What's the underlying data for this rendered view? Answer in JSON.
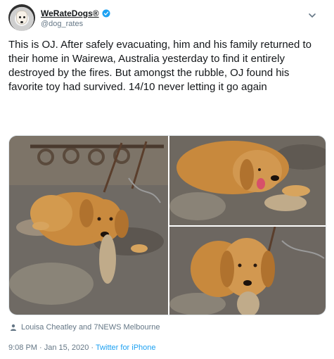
{
  "tweet": {
    "display_name": "WeRateDogs®",
    "handle": "@dog_rates",
    "text": "This is OJ. After safely evacuating, him and his family returned to their home in Wairewa, Australia yesterday to find it entirely destroyed by the fires. But amongst the rubble, OJ found his favorite toy had survived. 14/10 never letting it go again",
    "media_credit": "Louisa Cheatley and 7NEWS Melbourne",
    "time": "9:08 PM · Jan 15, 2020 · ",
    "source": "Twitter for iPhone"
  },
  "icons": {
    "verified": "verified-badge-icon",
    "menu": "chevron-down-icon",
    "credit": "person-icon"
  },
  "colors": {
    "accent": "#1da1f2",
    "muted_text": "#657786",
    "primary_text": "#14171a"
  }
}
